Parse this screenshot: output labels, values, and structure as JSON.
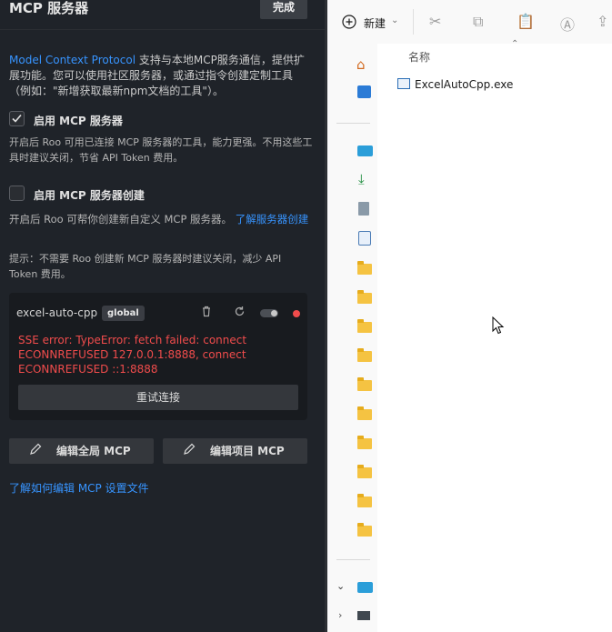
{
  "header": {
    "title": "MCP 服务器",
    "done_label": "完成"
  },
  "intro": {
    "link_text": "Model Context Protocol",
    "text": " 支持与本地MCP服务通信，提供扩展功能。您可以使用社区服务器，或通过指令创建定制工具（例如：\"新增获取最新npm文档的工具\"）。"
  },
  "enable_mcp": {
    "label": "启用 MCP 服务器",
    "checked": true,
    "hint": "开启后 Roo 可用已连接 MCP 服务器的工具，能力更强。不用这些工具时建议关闭，节省 API Token 费用。"
  },
  "enable_creation": {
    "label": "启用 MCP 服务器创建",
    "checked": false,
    "hint": "开启后 Roo 可帮你创建新自定义 MCP 服务器。",
    "hint_link": "了解服务器创建",
    "tip": "提示：不需要 Roo 创建新 MCP 服务器时建议关闭，减少 API Token 费用。"
  },
  "server": {
    "name": "excel-auto-cpp",
    "scope_badge": "global",
    "error_lines": [
      "SSE error: TypeError: fetch failed: connect",
      "ECONNREFUSED 127.0.0.1:8888, connect",
      "ECONNREFUSED ::1:8888"
    ],
    "retry_label": "重试连接",
    "status_color": "#f14c4c",
    "icons": [
      "trash-icon",
      "refresh-icon",
      "toggle-switch",
      "status-dot"
    ]
  },
  "actions": {
    "edit_global": "编辑全局 MCP",
    "edit_project": "编辑项目 MCP",
    "learn_link": "了解如何编辑 MCP 设置文件"
  },
  "explorer": {
    "new_label": "新建",
    "column_name": "名称",
    "files": [
      {
        "name": "ExcelAutoCpp.exe"
      }
    ]
  },
  "colors": {
    "panel_bg": "#1f2329",
    "link": "#3794ff",
    "error": "#f14c4c"
  }
}
